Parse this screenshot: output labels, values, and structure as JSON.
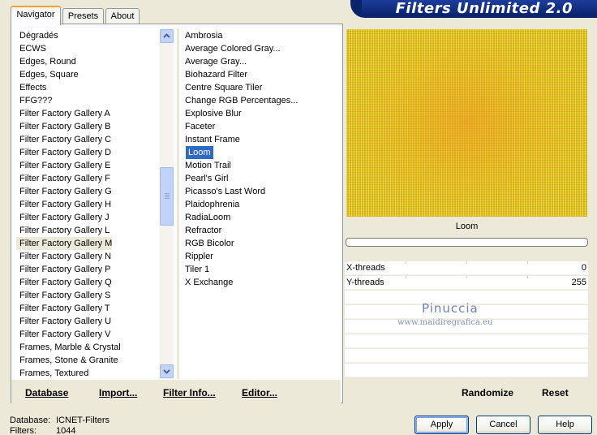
{
  "tabs": [
    {
      "label": "Navigator",
      "active": true
    },
    {
      "label": "Presets",
      "active": false
    },
    {
      "label": "About",
      "active": false
    }
  ],
  "banner": {
    "title": "Filters Unlimited 2.0"
  },
  "categories": [
    "Dégradés",
    "ECWS",
    "Edges, Round",
    "Edges, Square",
    "Effects",
    "FFG???",
    "Filter Factory Gallery A",
    "Filter Factory Gallery B",
    "Filter Factory Gallery C",
    "Filter Factory Gallery D",
    "Filter Factory Gallery E",
    "Filter Factory Gallery F",
    "Filter Factory Gallery G",
    "Filter Factory Gallery H",
    "Filter Factory Gallery J",
    "Filter Factory Gallery L",
    "Filter Factory Gallery M",
    "Filter Factory Gallery N",
    "Filter Factory Gallery P",
    "Filter Factory Gallery Q",
    "Filter Factory Gallery S",
    "Filter Factory Gallery T",
    "Filter Factory Gallery U",
    "Filter Factory Gallery V",
    "Frames, Marble & Crystal",
    "Frames, Stone & Granite",
    "Frames, Textured"
  ],
  "selected_category": "Filter Factory Gallery M",
  "filters": [
    "Ambrosia",
    "Average Colored Gray...",
    "Average Gray...",
    "Biohazard Filter",
    "Centre Square Tiler",
    "Change RGB Percentages...",
    "Explosive Blur",
    "Faceter",
    "Instant Frame",
    "Loom",
    "Motion Trail",
    "Pearl's Girl",
    "Picasso's Last Word",
    "Plaidophrenia",
    "RadiaLoom",
    "Refractor",
    "RGB Bicolor",
    "Rippler",
    "Tiler 1",
    "X Exchange"
  ],
  "selected_filter": "Loom",
  "preview": {
    "filter_name": "Loom",
    "colors": {
      "base": "#d8c21a",
      "center": "#f09620"
    }
  },
  "parameters": [
    {
      "label": "X-threads",
      "value": "0"
    },
    {
      "label": "Y-threads",
      "value": "255"
    }
  ],
  "watermark": {
    "name": "Pinuccia",
    "url": "www.maidiregrafica.eu"
  },
  "panel_buttons": {
    "database": "Database",
    "import": "Import...",
    "filter_info": "Filter Info...",
    "editor": "Editor...",
    "randomize": "Randomize",
    "reset": "Reset"
  },
  "status": {
    "database_label": "Database:",
    "database_value": "ICNET-Filters",
    "filters_label": "Filters:",
    "filters_value": "1044"
  },
  "dialog_buttons": {
    "apply": "Apply",
    "cancel": "Cancel",
    "help": "Help"
  }
}
